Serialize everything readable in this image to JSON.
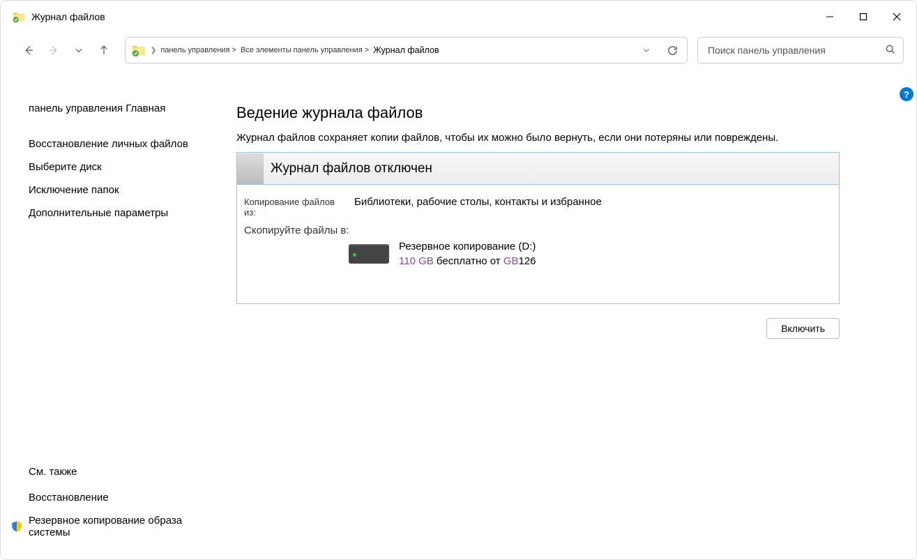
{
  "window": {
    "title": "Журнал файлов"
  },
  "breadcrumb": {
    "seg1": "панель управления >",
    "seg2": "Все элементы панель управления >",
    "seg3": "Журнал файлов"
  },
  "search": {
    "placeholder": "Поиск панель управления"
  },
  "sidebar": {
    "home": "панель управления Главная",
    "items": [
      "Восстановление личных файлов",
      "Выберите диск",
      "Исключение папок",
      "Дополнительные параметры"
    ],
    "see_also_heading": "См. также",
    "see_also": [
      "Восстановление",
      "Резервное копирование образа системы"
    ]
  },
  "main": {
    "heading": "Ведение журнала файлов",
    "description": "Журнал файлов сохраняет копии файлов, чтобы их можно было вернуть, если они потеряны или повреждены.",
    "status_title": "Журнал файлов отключен",
    "copy_from_label": "Копирование файлов из:",
    "copy_from_value": "Библиотеки, рабочие столы, контакты и избранное",
    "copy_to_label": "Скопируйте файлы в:",
    "drive_name": "Резервное копирование (D:)",
    "drive_free": "110 GB",
    "drive_free_suffix": " бесплатно от",
    "drive_total": "126",
    "drive_total_unit": "GB",
    "enable_button": "Включить"
  },
  "help": "?"
}
